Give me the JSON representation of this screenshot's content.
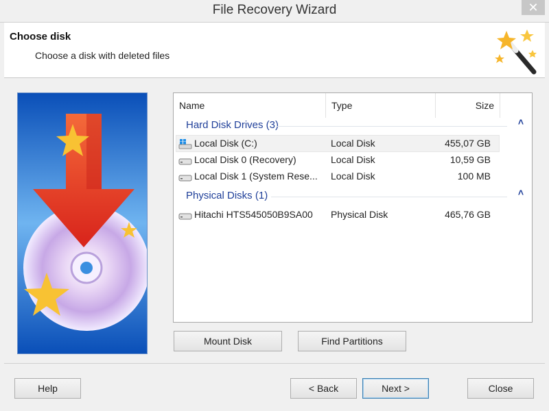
{
  "window": {
    "title": "File Recovery Wizard",
    "close_glyph": "✕"
  },
  "header": {
    "title": "Choose disk",
    "subtitle": "Choose a disk with deleted files"
  },
  "list": {
    "columns": {
      "name": "Name",
      "type": "Type",
      "size": "Size"
    },
    "groups": [
      {
        "label": "Hard Disk Drives (3)",
        "rows": [
          {
            "icon": "windows-disk-icon",
            "name": "Local Disk (C:)",
            "type": "Local Disk",
            "size": "455,07 GB",
            "selected": true
          },
          {
            "icon": "hard-drive-icon",
            "name": "Local Disk 0 (Recovery)",
            "type": "Local Disk",
            "size": "10,59 GB"
          },
          {
            "icon": "hard-drive-icon",
            "name": "Local Disk 1 (System Rese...",
            "type": "Local Disk",
            "size": "100 MB"
          }
        ]
      },
      {
        "label": "Physical Disks (1)",
        "rows": [
          {
            "icon": "hard-drive-icon",
            "name": "Hitachi HTS545050B9SA00",
            "type": "Physical Disk",
            "size": "465,76 GB"
          }
        ]
      }
    ],
    "chevron": "˄"
  },
  "actions": {
    "mount": "Mount Disk",
    "find_partitions": "Find Partitions"
  },
  "footer": {
    "help": "Help",
    "back": "< Back",
    "next": "Next >",
    "close": "Close"
  },
  "colors": {
    "group_text": "#1f3f99",
    "close_button": "#c7c7c7",
    "accent_border": "#3c7fb1"
  }
}
